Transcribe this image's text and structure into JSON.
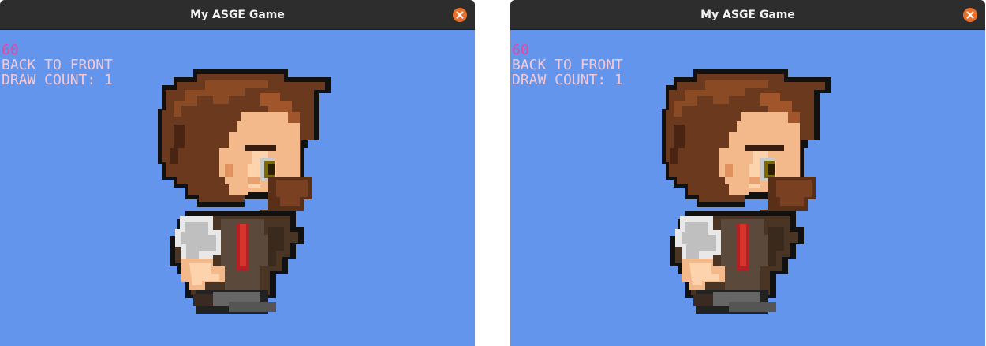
{
  "windows": [
    {
      "title": "My ASGE Game",
      "hud": {
        "fps": "60",
        "mode": "BACK TO FRONT",
        "draw_count": "DRAW COUNT: 1"
      }
    },
    {
      "title": "My ASGE Game",
      "hud": {
        "fps": "60",
        "mode": "BACK TO FRONT",
        "draw_count": "DRAW COUNT: 1"
      }
    }
  ],
  "colors": {
    "background": "#6495ed",
    "titlebar": "#2d2d2d",
    "close_button": "#e9702a",
    "hud_fps": "#e04aa4",
    "hud_text": "#f4c8d6"
  },
  "icons": {
    "close": "close-icon",
    "sprite": "character-sprite"
  }
}
